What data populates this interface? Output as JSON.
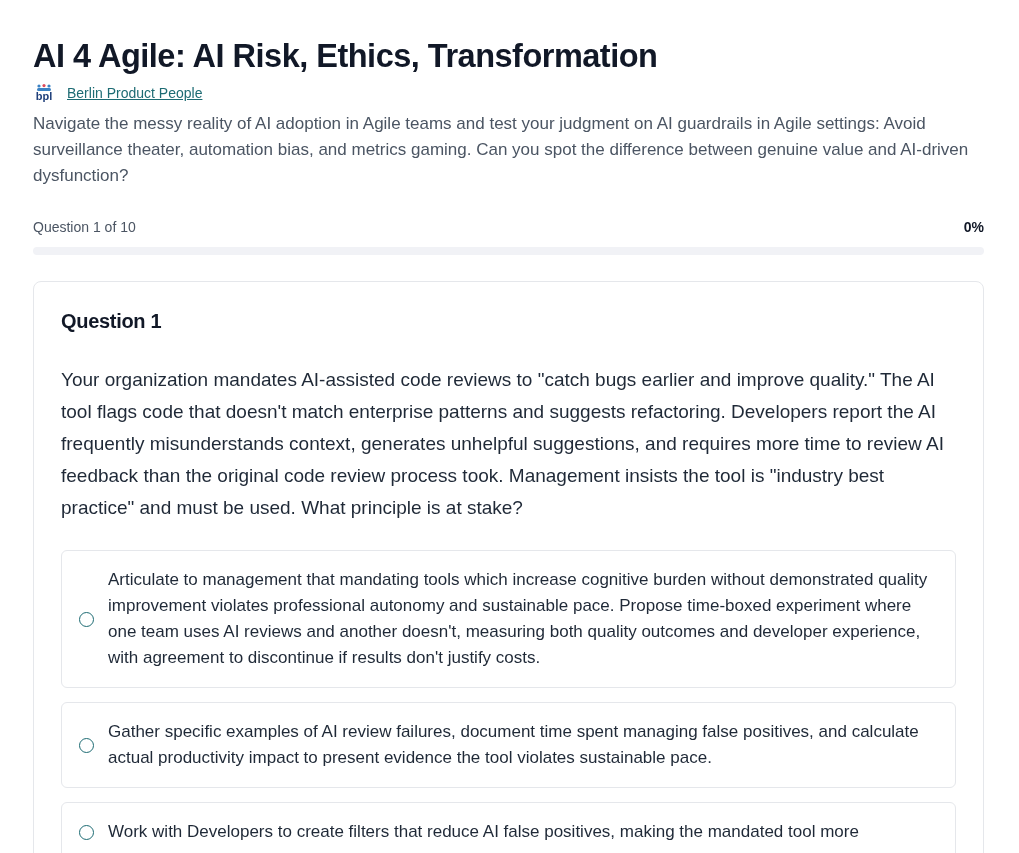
{
  "title": "AI 4 Agile: AI Risk, Ethics, Transformation",
  "author": {
    "logo_text": "bpl",
    "name": "Berlin Product People"
  },
  "description": "Navigate the messy reality of AI adoption in Agile teams and test your judgment on AI guardrails in Agile settings: Avoid surveillance theater, automation bias, and metrics gaming. Can you spot the difference between genuine value and AI-driven dysfunction?",
  "progress": {
    "label": "Question 1 of 10",
    "percent": "0%",
    "level": 0
  },
  "question": {
    "heading": "Question 1",
    "text": "Your organization mandates AI-assisted code reviews to \"catch bugs earlier and improve quality.\" The AI tool flags code that doesn't match enterprise patterns and suggests refactoring. Developers report the AI frequently misunderstands context, generates unhelpful suggestions, and requires more time to review AI feedback than the original code review process took. Management insists the tool is \"industry best practice\" and must be used. What principle is at stake?",
    "options": [
      {
        "text": "Articulate to management that mandating tools which increase cognitive burden without demonstrated quality improvement violates professional autonomy and sustainable pace. Propose time-boxed experiment where one team uses AI reviews and another doesn't, measuring both quality outcomes and developer experience, with agreement to discontinue if results don't justify costs.",
        "selected": false
      },
      {
        "text": "Gather specific examples of AI review failures, document time spent managing false positives, and calculate actual productivity impact to present evidence the tool violates sustainable pace.",
        "selected": false
      },
      {
        "text": "Work with Developers to create filters that reduce AI false positives, making the mandated tool more",
        "selected": false
      }
    ]
  }
}
